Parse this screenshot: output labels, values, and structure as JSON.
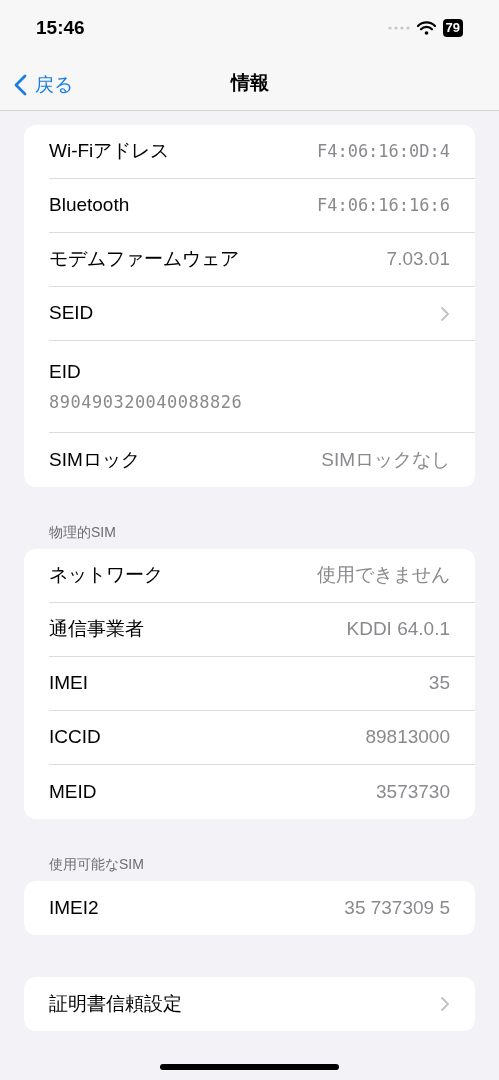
{
  "status_bar": {
    "time": "15:46",
    "battery": "79"
  },
  "nav": {
    "back": "戻る",
    "title": "情報"
  },
  "sections": [
    {
      "rows": [
        {
          "kind": "mono_value",
          "label": "Wi-Fiアドレス",
          "value": "F4:06:16:0D:4"
        },
        {
          "kind": "mono_value",
          "label": "Bluetooth",
          "value": "F4:06:16:16:6"
        },
        {
          "kind": "value",
          "label": "モデムファームウェア",
          "value": "7.03.01"
        },
        {
          "kind": "chevron",
          "label": "SEID"
        },
        {
          "kind": "stacked",
          "label": "EID",
          "value": "890490320040088826"
        },
        {
          "kind": "value",
          "label": "SIMロック",
          "value": "SIMロックなし"
        }
      ]
    },
    {
      "header": "物理的SIM",
      "rows": [
        {
          "kind": "value",
          "label": "ネットワーク",
          "value": "使用できません"
        },
        {
          "kind": "value",
          "label": "通信事業者",
          "value": "KDDI 64.0.1"
        },
        {
          "kind": "value",
          "label": "IMEI",
          "value": "35"
        },
        {
          "kind": "value",
          "label": "ICCID",
          "value": "89813000"
        },
        {
          "kind": "value",
          "label": "MEID",
          "value": "3573730"
        }
      ]
    },
    {
      "header": "使用可能なSIM",
      "rows": [
        {
          "kind": "value",
          "label": "IMEI2",
          "value": "35 737309 5"
        }
      ]
    },
    {
      "rows": [
        {
          "kind": "chevron",
          "label": "証明書信頼設定"
        }
      ]
    }
  ]
}
